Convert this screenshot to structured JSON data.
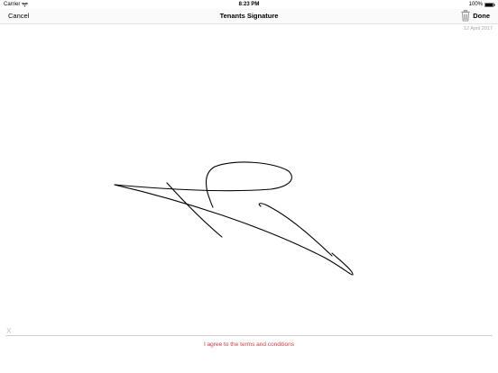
{
  "status_bar": {
    "carrier": "Carrier",
    "time": "8:23 PM",
    "battery": "100%",
    "wifi_icon": "wifi-icon",
    "battery_icon": "battery-full-icon"
  },
  "nav": {
    "cancel_label": "Cancel",
    "title": "Tenants Signature",
    "trash_icon": "trash-icon",
    "done_label": "Done"
  },
  "signature": {
    "date": "12 April 2017",
    "x_marker": "X",
    "agree_label": "I agree to the terms and conditions",
    "stroke_color": "#000000"
  },
  "colors": {
    "agree_text": "#e03a3a",
    "placeholder": "#a8a8a8"
  }
}
